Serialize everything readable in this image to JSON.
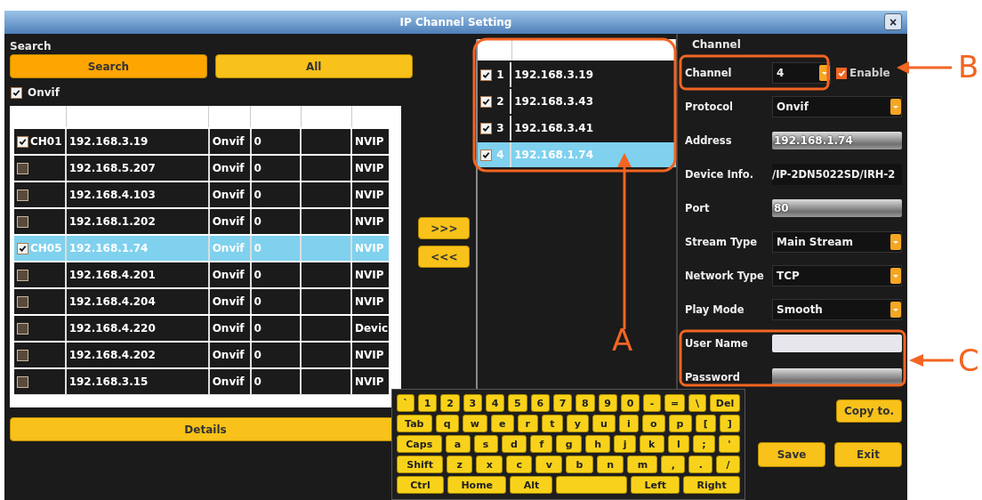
{
  "window": {
    "title": "IP Channel Setting",
    "close": "×"
  },
  "search": {
    "heading": "Search",
    "buttons": [
      "Search",
      "All"
    ],
    "onvif": {
      "label": "Onvif",
      "checked": true
    }
  },
  "devices": [
    {
      "checked": true,
      "selected": false,
      "channel": "CH01",
      "address": "192.168.3.19",
      "protocol": "Onvif",
      "port": "0",
      "device": "NVIP"
    },
    {
      "checked": false,
      "selected": false,
      "address": "192.168.5.207",
      "protocol": "Onvif",
      "port": "0",
      "device": "NVIP"
    },
    {
      "checked": false,
      "selected": false,
      "address": "192.168.4.103",
      "protocol": "Onvif",
      "port": "0",
      "device": "NVIP"
    },
    {
      "checked": false,
      "selected": false,
      "address": "192.168.1.202",
      "protocol": "Onvif",
      "port": "0",
      "device": "NVIP"
    },
    {
      "checked": true,
      "selected": true,
      "channel": "CH05",
      "address": "192.168.1.74",
      "protocol": "Onvif",
      "port": "0",
      "device": "NVIP"
    },
    {
      "checked": false,
      "selected": false,
      "address": "192.168.4.201",
      "protocol": "Onvif",
      "port": "0",
      "device": "NVIP"
    },
    {
      "checked": false,
      "selected": false,
      "address": "192.168.4.204",
      "protocol": "Onvif",
      "port": "0",
      "device": "NVIP"
    },
    {
      "checked": false,
      "selected": false,
      "address": "192.168.4.220",
      "protocol": "Onvif",
      "port": "0",
      "device": "Devic"
    },
    {
      "checked": false,
      "selected": false,
      "address": "192.168.4.202",
      "protocol": "Onvif",
      "port": "0",
      "device": "NVIP"
    },
    {
      "checked": false,
      "selected": false,
      "address": "192.168.3.15",
      "protocol": "Onvif",
      "port": "0",
      "device": "NVIP"
    }
  ],
  "details_button": "Details",
  "transfer_buttons": [
    ">>>",
    "<<<"
  ],
  "added": [
    {
      "checked": true,
      "selected": false,
      "number": "1",
      "address": "192.168.3.19"
    },
    {
      "checked": true,
      "selected": false,
      "number": "2",
      "address": "192.168.3.43"
    },
    {
      "checked": true,
      "selected": false,
      "number": "3",
      "address": "192.168.3.41"
    },
    {
      "checked": true,
      "selected": true,
      "number": "4",
      "address": "192.168.1.74"
    }
  ],
  "channel_panel": {
    "heading": "Channel",
    "fields": [
      {
        "kind": "select",
        "label": "Channel",
        "value": "4",
        "enable": {
          "label": "Enable",
          "checked": true
        }
      },
      {
        "kind": "select",
        "label": "Protocol",
        "value": "Onvif"
      },
      {
        "kind": "input",
        "label": "Address",
        "value": "192.168.1.74"
      },
      {
        "kind": "text",
        "label": "Device Info.",
        "value": "/IP-2DN5022SD/IRH-2"
      },
      {
        "kind": "input",
        "label": "Port",
        "value": "80"
      },
      {
        "kind": "select",
        "label": "Stream Type",
        "value": "Main Stream"
      },
      {
        "kind": "select",
        "label": "Network Type",
        "value": "TCP"
      },
      {
        "kind": "select",
        "label": "Play Mode",
        "value": "Smooth"
      },
      {
        "kind": "blank",
        "label": "User Name"
      },
      {
        "kind": "input",
        "label": "Password"
      }
    ],
    "copy_button": "Copy to.",
    "buttons": [
      "Save",
      "Exit"
    ]
  },
  "keyboard": {
    "rows": [
      {
        "keys": [
          {
            "kind": "key",
            "label": "`"
          },
          {
            "kind": "key",
            "label": "1"
          },
          {
            "kind": "key",
            "label": "2"
          },
          {
            "kind": "key",
            "label": "3"
          },
          {
            "kind": "key",
            "label": "4"
          },
          {
            "kind": "key",
            "label": "5"
          },
          {
            "kind": "key",
            "label": "6"
          },
          {
            "kind": "key",
            "label": "7"
          },
          {
            "kind": "key",
            "label": "8"
          },
          {
            "kind": "key",
            "label": "9"
          },
          {
            "kind": "key",
            "label": "0"
          },
          {
            "kind": "key",
            "label": "-"
          },
          {
            "kind": "key",
            "label": "="
          },
          {
            "kind": "key",
            "label": "\\"
          },
          {
            "kind": "key",
            "label": "Del"
          }
        ]
      },
      {
        "keys": [
          {
            "kind": "key",
            "label": "Tab"
          },
          {
            "kind": "key",
            "label": "q"
          },
          {
            "kind": "key",
            "label": "w"
          },
          {
            "kind": "key",
            "label": "e"
          },
          {
            "kind": "key",
            "label": "r"
          },
          {
            "kind": "key",
            "label": "t"
          },
          {
            "kind": "key",
            "label": "y"
          },
          {
            "kind": "key",
            "label": "u"
          },
          {
            "kind": "key",
            "label": "i"
          },
          {
            "kind": "key",
            "label": "o"
          },
          {
            "kind": "key",
            "label": "p"
          },
          {
            "kind": "key",
            "label": "["
          },
          {
            "kind": "key",
            "label": "]"
          }
        ]
      },
      {
        "keys": [
          {
            "kind": "key",
            "label": "Caps"
          },
          {
            "kind": "key",
            "label": "a"
          },
          {
            "kind": "key",
            "label": "s"
          },
          {
            "kind": "key",
            "label": "d"
          },
          {
            "kind": "key",
            "label": "f"
          },
          {
            "kind": "key",
            "label": "g"
          },
          {
            "kind": "key",
            "label": "h"
          },
          {
            "kind": "key",
            "label": "j"
          },
          {
            "kind": "key",
            "label": "k"
          },
          {
            "kind": "key",
            "label": "l"
          },
          {
            "kind": "key",
            "label": ";"
          },
          {
            "kind": "key",
            "label": "'"
          }
        ]
      },
      {
        "keys": [
          {
            "kind": "key",
            "label": "Shift"
          },
          {
            "kind": "key",
            "label": "z"
          },
          {
            "kind": "key",
            "label": "x"
          },
          {
            "kind": "key",
            "label": "c"
          },
          {
            "kind": "key",
            "label": "v"
          },
          {
            "kind": "key",
            "label": "b"
          },
          {
            "kind": "key",
            "label": "n"
          },
          {
            "kind": "key",
            "label": "m"
          },
          {
            "kind": "key",
            "label": ","
          },
          {
            "kind": "key",
            "label": "."
          },
          {
            "kind": "key",
            "label": "/"
          }
        ]
      },
      {
        "keys": [
          {
            "kind": "key",
            "label": "Ctrl"
          },
          {
            "kind": "key",
            "label": "Home"
          },
          {
            "kind": "key",
            "label": "Alt"
          },
          {
            "kind": "space"
          },
          {
            "kind": "key",
            "label": "Left"
          },
          {
            "kind": "key",
            "label": "Right"
          }
        ]
      }
    ]
  },
  "callouts": [
    {
      "label": "A"
    },
    {
      "label": "B"
    },
    {
      "label": "C"
    }
  ]
}
